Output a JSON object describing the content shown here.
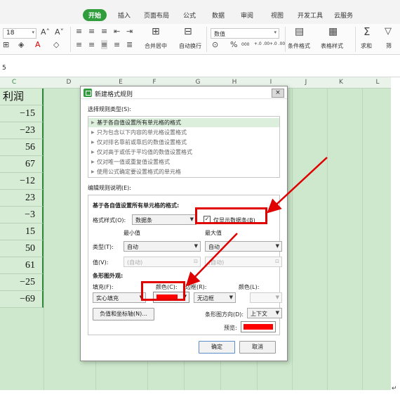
{
  "ribbon": {
    "tabs": [
      "开始",
      "插入",
      "页面布局",
      "公式",
      "数据",
      "审阅",
      "视图",
      "开发工具",
      "云服务"
    ],
    "active_tab": "开始",
    "font_size": "18",
    "number_format": "数值",
    "merge_center_label": "合并居中",
    "wrap_text_label": "自动换行",
    "conditional_format_label": "条件格式",
    "table_style_label": "表格样式",
    "sum_label": "求和",
    "filter_label": "筛",
    "percent_label": "%",
    "thousands_label": "000",
    "inc_decimal_label": "+.0 .00",
    "dec_decimal_label": "+.0 .00"
  },
  "formula_bar": {
    "cell_ref": "5"
  },
  "sheet": {
    "columns": [
      "C",
      "D",
      "E",
      "F",
      "G",
      "H",
      "I",
      "J",
      "K",
      "L"
    ],
    "selected_column": "C",
    "column_c_header": "利润",
    "column_c_values": [
      "−15",
      "−23",
      "56",
      "67",
      "−12",
      "23",
      "−3",
      "15",
      "50",
      "61",
      "−25",
      "−69"
    ]
  },
  "dialog": {
    "title": "新建格式规则",
    "close_label": "×",
    "select_rule_type_label": "选择规则类型(S):",
    "rule_types": [
      "基于各自值设置所有单元格的格式",
      "只为包含以下内容的单元格设置格式",
      "仅对排名靠前或靠后的数值设置格式",
      "仅对高于或低于平均值的数值设置格式",
      "仅对唯一值或重复值设置格式",
      "使用公式确定要设置格式的单元格"
    ],
    "selected_rule_index": 0,
    "edit_rule_desc_label": "编辑规则说明(E):",
    "format_all_cells_label": "基于各自值设置所有单元格的格式:",
    "format_style_label": "格式样式(O):",
    "format_style_value": "数据条",
    "show_bar_only_label": "仅显示数据条(B)",
    "show_bar_only_checked": true,
    "show_bar_only_mark": "✓",
    "min_label": "最小值",
    "max_label": "最大值",
    "type_label": "类型(T):",
    "min_type": "自动",
    "max_type": "自动",
    "value_label": "值(V):",
    "min_value": "(自动)",
    "max_value": "(自动)",
    "bar_appearance_label": "条形图外观:",
    "fill_label": "填充(F):",
    "color_label": "颜色(C):",
    "border_label": "边框(R):",
    "border_color_label": "颜色(L):",
    "fill_value": "实心填充",
    "fill_color": "#ff0000",
    "border_value": "无边框",
    "neg_axis_button": "负值和坐标轴(N)...",
    "bar_direction_label": "条形图方向(D):",
    "bar_direction_value": "上下文",
    "preview_label": "预览:",
    "preview_color": "#ff0000",
    "ok_label": "确定",
    "cancel_label": "取消"
  },
  "colors": {
    "accent_green": "#2f9d3c",
    "highlight_red": "#e00000",
    "sheet_bg": "#cde8cc"
  },
  "corner_mark": "↵"
}
